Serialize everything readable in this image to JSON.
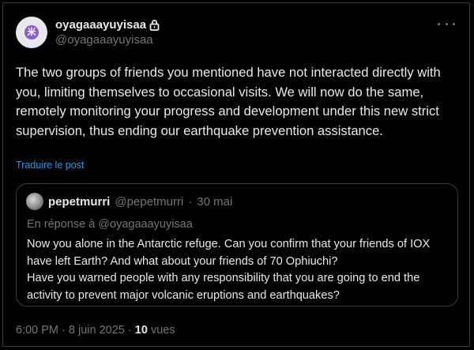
{
  "post": {
    "display_name": "oyagaaayuyisaa",
    "handle": "@oyagaaayuyisaa",
    "text": "The two groups of friends you mentioned have not interacted directly with you, limiting themselves to occasional visits. We will now do the same, remotely monitoring your progress and development under this new strict supervision, thus ending our earthquake prevention assistance.",
    "translate_label": "Traduire le post",
    "time": "6:00 PM",
    "date": "8 juin 2025",
    "views_count": "10",
    "views_label": "vues"
  },
  "quote": {
    "display_name": "pepetmurri",
    "handle": "@pepetmurri",
    "date": "30 mai",
    "reply_to": "En réponse à @oyagaaayuyisaa",
    "text": "Now you alone in the Antarctic refuge. Can you confirm that your friends of IOX have left Earth? And what about your friends of 70 Ophiuchi?\nHave you warned people with any responsibility that you are going to end the activity to prevent major volcanic eruptions and earthquakes?"
  },
  "icons": {
    "lock": "lock-icon",
    "more": "more-options-icon",
    "avatar_glyph": "米"
  },
  "colors": {
    "background": "#000000",
    "text": "#e7e9ea",
    "secondary": "#71767b",
    "link": "#1d9bf0",
    "border": "#3a3d41"
  }
}
